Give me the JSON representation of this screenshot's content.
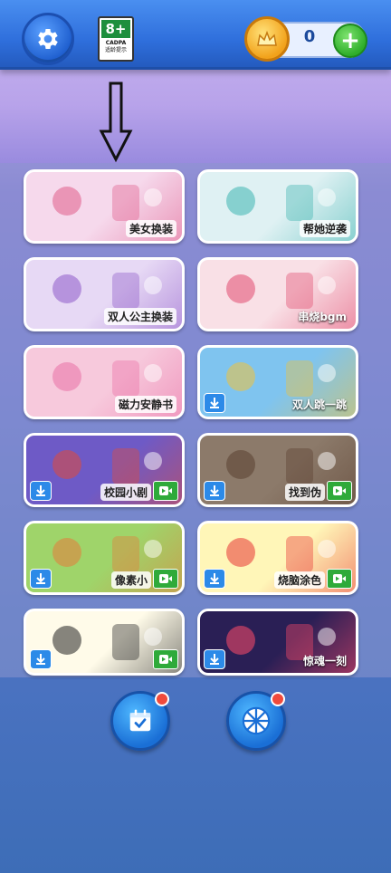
{
  "header": {
    "age_rating": "8+",
    "age_org": "CADPA",
    "age_note": "适龄提示",
    "coins": "0"
  },
  "games": [
    {
      "title": "美女换装",
      "bg": "#f6d9ec",
      "accent": "#e05c8b",
      "download": false,
      "video": false,
      "light": false
    },
    {
      "title": "帮她逆袭",
      "bg": "#dff1f3",
      "accent": "#3cb4b0",
      "download": false,
      "video": false,
      "light": false
    },
    {
      "title": "双人公主换装",
      "bg": "#e7d9f5",
      "accent": "#8e59c9",
      "download": false,
      "video": false,
      "light": false
    },
    {
      "title": "串烧bgm",
      "bg": "#f9e0e6",
      "accent": "#e24a6f",
      "download": false,
      "video": false,
      "light": true
    },
    {
      "title": "磁力安静书",
      "bg": "#f7c9dc",
      "accent": "#ea6fa5",
      "download": false,
      "video": false,
      "light": false
    },
    {
      "title": "双人跳一跳",
      "bg": "#7fc4ef",
      "accent": "#f0c23a",
      "download": true,
      "video": false,
      "light": true
    },
    {
      "title": "校园小剧",
      "bg": "#6e5ac6",
      "accent": "#e04b3a",
      "download": true,
      "video": true,
      "light": false
    },
    {
      "title": "找到伪",
      "bg": "#8c7a6a",
      "accent": "#5a3f2f",
      "download": true,
      "video": true,
      "light": false
    },
    {
      "title": "像素小",
      "bg": "#9fd46a",
      "accent": "#e57a3a",
      "download": true,
      "video": true,
      "light": false
    },
    {
      "title": "烧脑涂色",
      "bg": "#fff6b8",
      "accent": "#e83434",
      "download": true,
      "video": true,
      "light": false
    },
    {
      "title": "",
      "bg": "#fffbe9",
      "accent": "#222222",
      "download": true,
      "video": true,
      "light": false
    },
    {
      "title": "惊魂一刻",
      "bg": "#2a1f55",
      "accent": "#ff4a6a",
      "download": true,
      "video": false,
      "light": true
    }
  ],
  "bottom_buttons": [
    {
      "name": "checkin-calendar-button",
      "icon": "calendar-check-icon",
      "has_badge": true
    },
    {
      "name": "lucky-wheel-button",
      "icon": "wheel-icon",
      "has_badge": true
    }
  ]
}
